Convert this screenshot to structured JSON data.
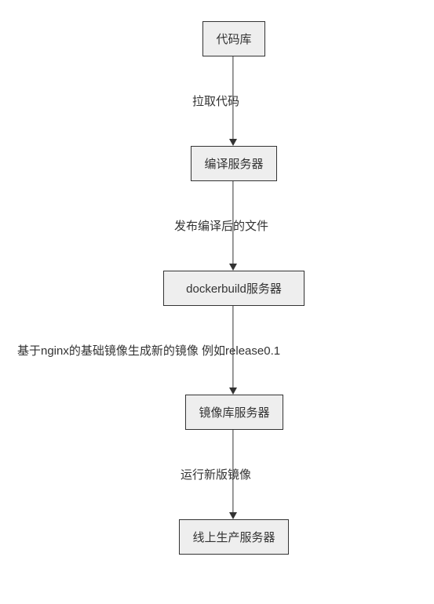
{
  "nodes": {
    "n1": "代码库",
    "n2": "编译服务器",
    "n3": "dockerbuild服务器",
    "n4": "镜像库服务器",
    "n5": "线上生产服务器"
  },
  "edges": {
    "e1": "拉取代码",
    "e2": "发布编译后的文件",
    "e3": "基于nginx的基础镜像生成新的镜像 例如release0.1",
    "e4": "运行新版镜像"
  }
}
